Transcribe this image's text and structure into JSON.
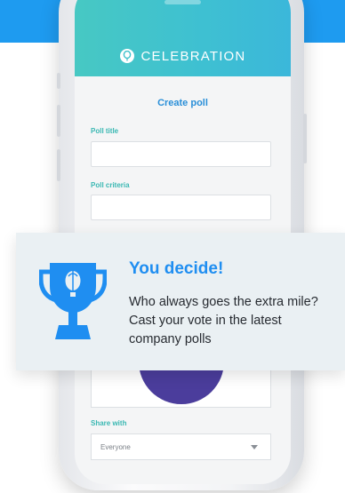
{
  "app": {
    "brand_name": "CELEBRATION"
  },
  "form": {
    "title": "Create poll",
    "poll_title_label": "Poll title",
    "poll_title_value": "",
    "poll_criteria_label": "Poll criteria",
    "poll_criteria_value": "",
    "share_with_label": "Share with",
    "share_with_value": "Everyone"
  },
  "promo": {
    "heading": "You decide!",
    "body": "Who always goes the extra mile? Cast your vote in the latest company polls"
  },
  "colors": {
    "top_band": "#1e9bf0",
    "header_teal": "#45c6c6",
    "accent_blue": "#1f8ef1",
    "label_teal": "#3ab8b3",
    "purple": "#4b3d9c"
  },
  "icons": {
    "brand": "balloon-logo-icon",
    "promo": "trophy-icon",
    "select": "chevron-down-icon"
  }
}
